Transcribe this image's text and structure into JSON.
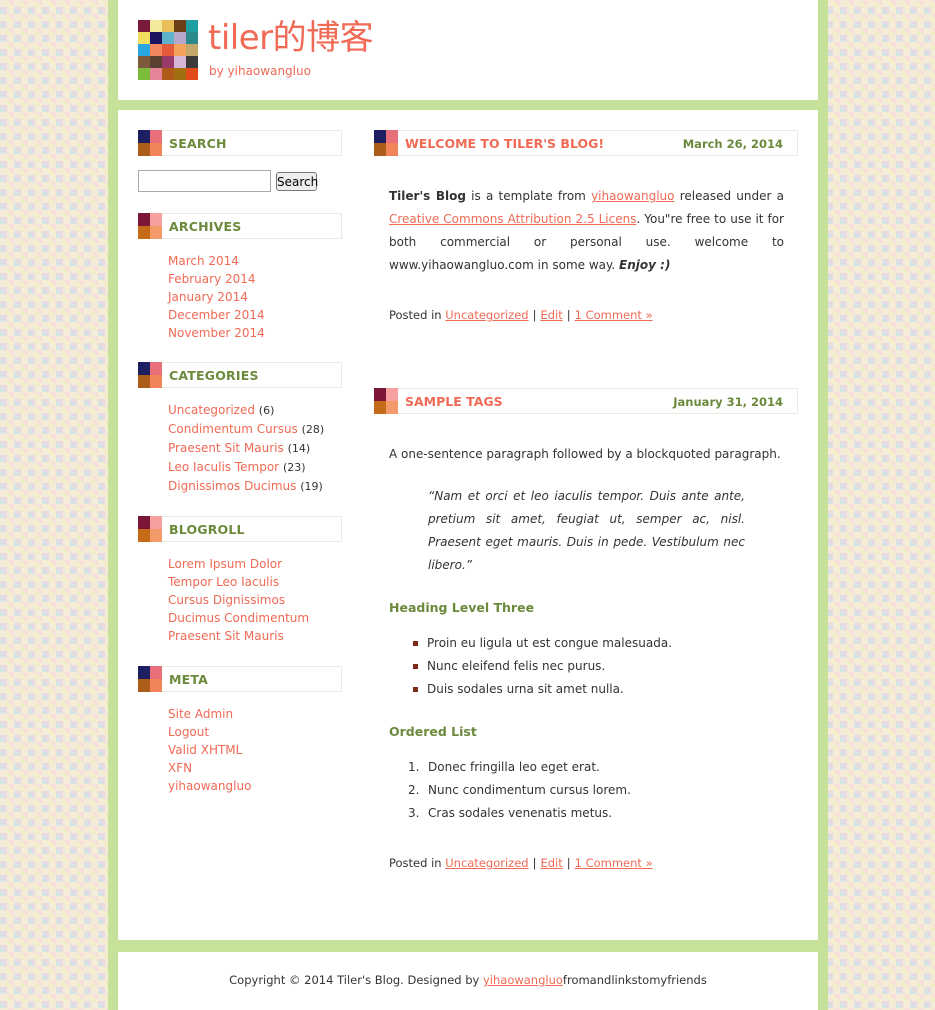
{
  "header": {
    "title": "tiler的博客",
    "subtitle": "by yihaowangluo",
    "logo_colors": [
      "#7a1a3a",
      "#f2ea9a",
      "#e7be57",
      "#6b3f17",
      "#1f9fa3",
      "#f3df5f",
      "#1b1560",
      "#5fb2c9",
      "#b7a7c9",
      "#2a8a8c",
      "#2aa7e0",
      "#f3865f",
      "#e45a3a",
      "#f2a25a",
      "#c4a86a",
      "#7c5a3a",
      "#5a4030",
      "#9a3a6a",
      "#d6b6d6",
      "#3a3a3a",
      "#7bbd3a",
      "#e6859a",
      "#b05a1a",
      "#a07010",
      "#e24a1a"
    ]
  },
  "sidebar": {
    "search": {
      "title": "SEARCH",
      "button": "Search",
      "placeholder": ""
    },
    "archives": {
      "title": "ARCHIVES",
      "items": [
        "March 2014",
        "February 2014",
        "January 2014",
        "December 2014",
        "November 2014"
      ]
    },
    "categories": {
      "title": "CATEGORIES",
      "items": [
        {
          "label": "Uncategorized",
          "count": "(6)"
        },
        {
          "label": "Condimentum Cursus",
          "count": "(28)"
        },
        {
          "label": "Praesent Sit Mauris",
          "count": "(14)"
        },
        {
          "label": "Leo Iaculis Tempor",
          "count": "(23)"
        },
        {
          "label": "Dignissimos Ducimus",
          "count": "(19)"
        }
      ]
    },
    "blogroll": {
      "title": "BLOGROLL",
      "items": [
        "Lorem Ipsum Dolor",
        "Tempor Leo Iaculis",
        "Cursus Dignissimos",
        "Ducimus Condimentum",
        "Praesent Sit Mauris"
      ]
    },
    "meta": {
      "title": "META",
      "items": [
        "Site Admin",
        "Logout",
        "Valid XHTML",
        "XFN",
        "yihaowangluo"
      ]
    }
  },
  "posts": [
    {
      "title": "WELCOME TO TILER'S BLOG!",
      "date": "March 26, 2014",
      "body": {
        "strong": "Tiler's Blog",
        "t1": " is a template from ",
        "link1": "yihaowangluo",
        "t2": " released under a ",
        "link2": "Creative Commons Attribution 2.5 Licens",
        "t3": ". You\"re free to use it for both commercial or personal use. welcome to www.yihaowangluo.com in some way. ",
        "em": "Enjoy :)"
      },
      "meta": {
        "prefix": "Posted in",
        "category": "Uncategorized",
        "edit": "Edit",
        "comments": "1 Comment »"
      }
    },
    {
      "title": "SAMPLE TAGS",
      "date": "January 31, 2014",
      "intro": "A one-sentence paragraph followed by a blockquoted paragraph.",
      "quote": "“Nam et orci et leo iaculis tempor. Duis ante ante, pretium sit amet, feugiat ut, semper ac, nisl. Praesent eget mauris. Duis in pede. Vestibulum nec libero.”",
      "h3_a": "Heading Level Three",
      "ul": [
        "Proin eu ligula ut est congue malesuada.",
        "Nunc eleifend felis nec purus.",
        "Duis sodales urna sit amet nulla."
      ],
      "h3_b": "Ordered List",
      "ol": [
        {
          "num": "1.",
          "text": "Donec fringilla leo eget erat."
        },
        {
          "num": "2.",
          "text": "Nunc condimentum cursus lorem."
        },
        {
          "num": "3.",
          "text": "Cras sodales venenatis metus."
        }
      ],
      "meta": {
        "prefix": "Posted in",
        "category": "Uncategorized",
        "edit": "Edit",
        "comments": "1 Comment »"
      }
    }
  ],
  "footer": {
    "prefix": "Copyright © 2014 Tiler's Blog. Designed by ",
    "link": "yihaowangluo",
    "suffix": "fromandlinkstomyfriends"
  }
}
